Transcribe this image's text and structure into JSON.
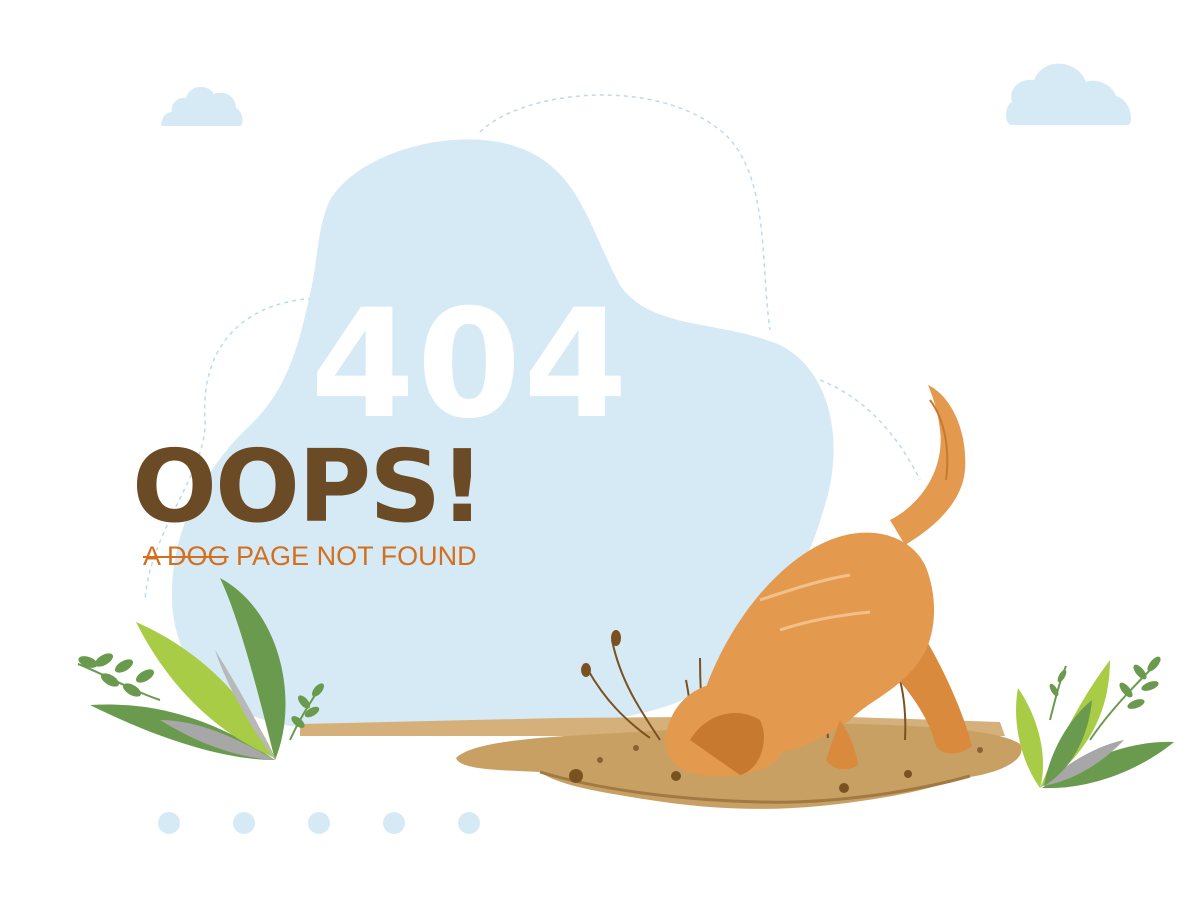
{
  "error": {
    "code": "404",
    "headline": "OOPS!",
    "struck_text": "A DOG",
    "message": "PAGE NOT FOUND"
  },
  "illustration": {
    "subject": "dog-digging-hole",
    "icons": [
      "cloud-icon",
      "leaf-icon",
      "dog-icon",
      "dirt-mound-icon"
    ]
  },
  "pagination_dots": {
    "count": 5
  },
  "colors": {
    "background": "#ffffff",
    "blob": "#d6eaf5",
    "headline": "#6b4a26",
    "message": "#d2701f",
    "code": "#ffffff",
    "dog": "#e39a4e",
    "dirt": "#c9a063",
    "leaf_green": "#6a9a4e",
    "leaf_lime": "#a8cc45"
  }
}
